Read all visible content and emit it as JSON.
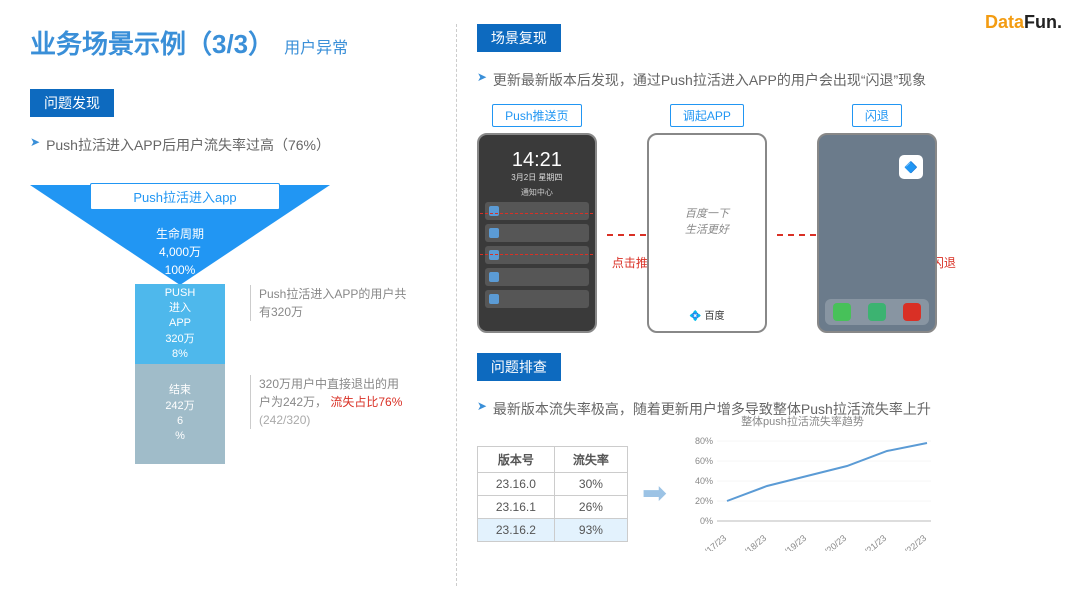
{
  "logo": {
    "brand1": "Data",
    "brand2": "Fun."
  },
  "title": {
    "main": "业务场景示例（3/3）",
    "sub": "用户异常"
  },
  "left": {
    "tag": "问题发现",
    "bullet": "Push拉活进入APP后用户流失率过高（76%）",
    "funnel": {
      "top_label": "Push拉活进入app",
      "stage1": {
        "name": "生命周期",
        "value": "4,000万",
        "pct": "100%"
      },
      "stage2": {
        "name": "PUSH",
        "l2": "进入",
        "l3": "APP",
        "value": "320万",
        "pct": "8%"
      },
      "stage3": {
        "name": "结束",
        "value": "242万",
        "l3": "6",
        "pct": "%"
      },
      "anno1": "Push拉活进入APP的用户共有320万",
      "anno2_a": "320万用户中直接退出的用户为242万，",
      "anno2_b": "流失占比76%",
      "anno2_c": "(242/320)"
    }
  },
  "right": {
    "tag1": "场景复现",
    "bullet1": "更新最新版本后发现，通过Push拉活进入APP的用户会出现“闪退”现象",
    "phones": {
      "p1_label": "Push推送页",
      "p1_time": "14:21",
      "p1_date": "3月2日 星期四",
      "p1_center": "通知中心",
      "arrow1": "点击推送内容，调起app",
      "p2_label": "调起APP",
      "p2_text1": "百度一下",
      "p2_text2": "生活更好",
      "p2_brand": "💠 百度",
      "p3_label": "闪退",
      "arrow2": "进入APP后闪退"
    },
    "tag2": "问题排查",
    "bullet2": "最新版本流失率极高，随着更新用户增多导致整体Push拉活流失率上升",
    "table": {
      "h1": "版本号",
      "h2": "流失率",
      "rows": [
        {
          "v": "23.16.0",
          "r": "30%"
        },
        {
          "v": "23.16.1",
          "r": "26%"
        },
        {
          "v": "23.16.2",
          "r": "93%"
        }
      ]
    },
    "chart_title": "整体push拉活流失率趋势"
  },
  "chart_data": {
    "type": "line",
    "title": "整体push拉活流失率趋势",
    "xlabel": "",
    "ylabel": "",
    "ylim": [
      0,
      80
    ],
    "y_ticks": [
      "0%",
      "20%",
      "40%",
      "60%",
      "80%"
    ],
    "categories": [
      "2/17/23",
      "2/18/23",
      "2/19/23",
      "2/20/23",
      "2/21/23",
      "2/22/23"
    ],
    "values": [
      20,
      35,
      45,
      55,
      70,
      78
    ]
  }
}
